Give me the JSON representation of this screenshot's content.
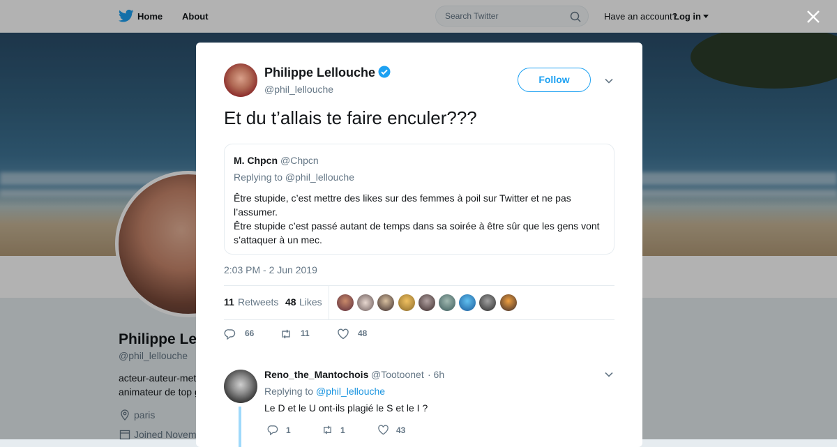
{
  "nav": {
    "home_label": "Home",
    "about_label": "About",
    "search_placeholder": "Search Twitter",
    "have_account": "Have an account?",
    "login_label": "Log in"
  },
  "profile": {
    "name": "Philippe Le",
    "handle": "@phil_lellouche",
    "bio_line1": "acteur-auteur-met",
    "bio_line2": "animateur de top g",
    "location": "paris",
    "joined": "Joined Novem"
  },
  "tweet": {
    "author_name": "Philippe Lellouche",
    "author_handle": "@phil_lellouche",
    "follow_label": "Follow",
    "text": "Et du t’allais te faire enculer???",
    "timestamp": "2:03 PM - 2 Jun 2019",
    "retweets_count": "11",
    "retweets_label": "Retweets",
    "likes_count": "48",
    "likes_label": "Likes",
    "reply_count": "66",
    "retweet_count_action": "11",
    "like_count_action": "48",
    "accent_color": "#1da1f2"
  },
  "quoted": {
    "name": "M. Chpcn",
    "handle": "@Chpcn",
    "replying": "Replying to @phil_lellouche",
    "body_lines": [
      "Être stupide, c’est mettre des likes sur des femmes à poil sur Twitter et ne pas",
      "l’assumer.",
      "Être stupide c’est passé autant de temps dans sa soirée à être sûr que les gens vont",
      "s’attaquer à un mec."
    ]
  },
  "reply": {
    "name": "Reno_the_Mantochois",
    "handle": "@Tootoonet",
    "time": "· 6h",
    "replying_label": "Replying to",
    "replying_to": "@phil_lellouche",
    "text": "Le D et le U ont-ils plagié le S et le I ?",
    "reply_count": "1",
    "retweet_count": "1",
    "like_count": "43"
  }
}
